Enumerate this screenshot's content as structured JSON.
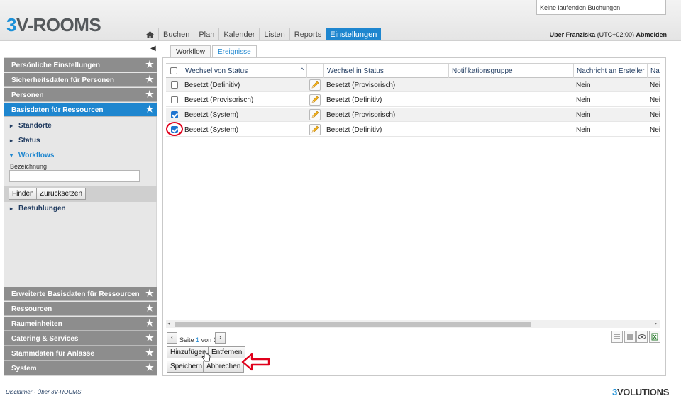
{
  "header": {
    "logo_prefix": "3",
    "logo_rest": "V-ROOMS",
    "booking_status": "Keine laufenden Buchungen",
    "nav": [
      "Buchen",
      "Plan",
      "Kalender",
      "Listen",
      "Reports",
      "Einstellungen"
    ],
    "nav_active": "Einstellungen",
    "user_name": "Uber Franziska",
    "timezone": "(UTC+02:00)",
    "logout": "Abmelden"
  },
  "sidebar": {
    "sections_top": [
      "Persönliche Einstellungen",
      "Sicherheitsdaten für Personen",
      "Personen",
      "Basisdaten für Ressourcen"
    ],
    "active_section": "Basisdaten für Ressourcen",
    "sub_items": [
      "Standorte",
      "Status",
      "Workflows",
      "Bestuhlungen"
    ],
    "open_sub_item": "Workflows",
    "filter_label": "Bezeichnung",
    "find_button": "Finden",
    "reset_button": "Zurücksetzen",
    "sections_bottom": [
      "Erweiterte Basisdaten für Ressourcen",
      "Ressourcen",
      "Raumeinheiten",
      "Catering & Services",
      "Stammdaten für Anlässe",
      "System"
    ]
  },
  "tabs": [
    "Workflow",
    "Ereignisse"
  ],
  "active_tab": "Ereignisse",
  "grid": {
    "columns": [
      "Wechsel von Status",
      "Wechsel in Status",
      "Notifikationsgruppe",
      "Nachricht an Ersteller",
      "Nac"
    ],
    "rows": [
      {
        "from": "Besetzt (Definitiv)",
        "to": "Besetzt (Provisorisch)",
        "group": "",
        "notify": "Nein",
        "extra": "Nei",
        "checked": false
      },
      {
        "from": "Besetzt (Provisorisch)",
        "to": "Besetzt (Definitiv)",
        "group": "",
        "notify": "Nein",
        "extra": "Nei",
        "checked": false
      },
      {
        "from": "Besetzt (System)",
        "to": "Besetzt (Provisorisch)",
        "group": "",
        "notify": "Nein",
        "extra": "Nei",
        "checked": true
      },
      {
        "from": "Besetzt (System)",
        "to": "Besetzt (Definitiv)",
        "group": "",
        "notify": "Nein",
        "extra": "Nei",
        "checked": true
      }
    ]
  },
  "pager": {
    "prefix": "Seite",
    "page": "1",
    "of": "von",
    "total": "1"
  },
  "actions": {
    "add": "Hinzufügen",
    "remove": "Entfernen",
    "save": "Speichern",
    "cancel": "Abbrechen"
  },
  "footer": {
    "disclaimer": "Disclaimer",
    "sep": "-",
    "about": "Über 3V-ROOMS",
    "logo_prefix": "3",
    "logo_rest": "VOLUTIONS"
  },
  "colors": {
    "accent": "#1e86cf",
    "sidebar_header": "#8d8d8d",
    "annotation": "#e0001b"
  }
}
